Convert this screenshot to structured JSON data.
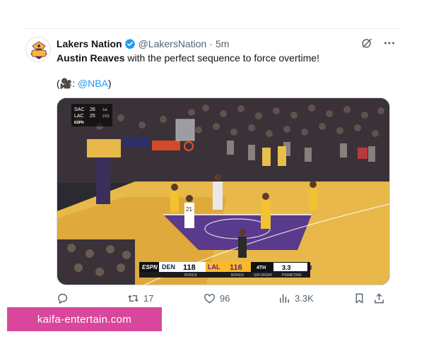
{
  "tweet": {
    "display_name": "Lakers Nation",
    "handle": "@LakersNation",
    "separator": "·",
    "time": "5m",
    "text_bold": "Austin Reaves",
    "text_rest": " with the perfect sequence to force overtime!",
    "credit_open": "(",
    "credit_icon": "🎥",
    "credit_colon": ": ",
    "credit_link": "@NBA",
    "credit_close": ")"
  },
  "video": {
    "corner_score": {
      "team1": "SAC",
      "score1": "26",
      "period1": "1st",
      "team2": "LAC",
      "score2": "25",
      "period2": "2:01",
      "network": "ESPN"
    },
    "scorebug": {
      "network": "ESPN",
      "away_team": "DEN",
      "away_score": "118",
      "home_team": "LAL",
      "home_score": "116",
      "quarter": "4TH",
      "clock": "3.3",
      "away_status": "BONUS",
      "home_status": "BONUS",
      "broadcast": "SATURDAY",
      "broadcast_brand": "PRIMETIME"
    },
    "player_number": "21"
  },
  "actions": {
    "replies": "",
    "reposts": "17",
    "likes": "96",
    "views": "3.3K"
  },
  "watermark": "kaifa-entertain.com",
  "colors": {
    "link": "#1d9bf0",
    "verified": "#1d9bf0",
    "lakers_purple": "#552583",
    "lakers_gold": "#fdb927",
    "watermark_bg": "#d9479d"
  }
}
